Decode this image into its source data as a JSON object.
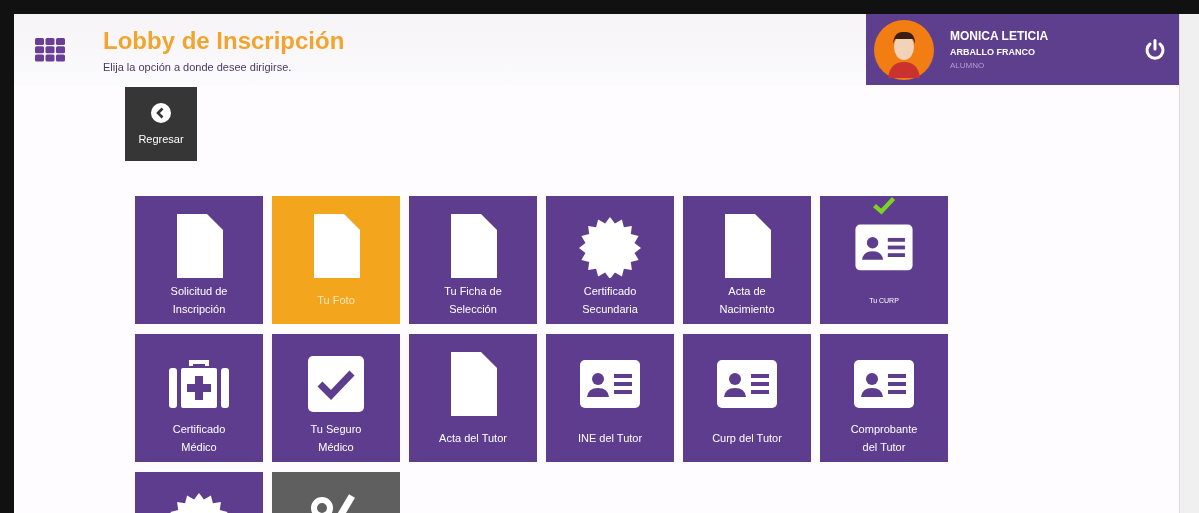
{
  "header": {
    "title": "Lobby de Inscripción",
    "subtitle": "Elija la opción a donde desee dirigirse."
  },
  "user": {
    "first_names": "MONICA LETICIA",
    "last_names": "ARBALLO FRANCO",
    "role": "ALUMNO"
  },
  "back_button": {
    "label": "Regresar"
  },
  "tiles": [
    {
      "kind": "document",
      "label": "Solicitud de Inscripción",
      "selected": false,
      "checked": false,
      "disabled": false
    },
    {
      "kind": "document",
      "label": "Tu Foto",
      "selected": true,
      "checked": false,
      "disabled": false
    },
    {
      "kind": "document",
      "label": "Tu Ficha de Selección",
      "selected": false,
      "checked": false,
      "disabled": false
    },
    {
      "kind": "seal",
      "label": "Certificado Secundaria",
      "selected": false,
      "checked": false,
      "disabled": false
    },
    {
      "kind": "document",
      "label": "Acta de Nacimiento",
      "selected": false,
      "checked": false,
      "disabled": false
    },
    {
      "kind": "id-card",
      "label": "Tu CURP",
      "selected": false,
      "checked": true,
      "disabled": false
    },
    {
      "kind": "medkit",
      "label": "Certificado Médico",
      "selected": false,
      "checked": false,
      "disabled": false
    },
    {
      "kind": "check",
      "label": "Tu Seguro Médico",
      "selected": false,
      "checked": false,
      "disabled": false
    },
    {
      "kind": "document",
      "label": "Acta del Tutor",
      "selected": false,
      "checked": false,
      "disabled": false
    },
    {
      "kind": "id-card",
      "label": "INE del Tutor",
      "selected": false,
      "checked": false,
      "disabled": false
    },
    {
      "kind": "id-card",
      "label": "Curp del Tutor",
      "selected": false,
      "checked": false,
      "disabled": false
    },
    {
      "kind": "id-card",
      "label": "Comprobante del Tutor",
      "selected": false,
      "checked": false,
      "disabled": false
    },
    {
      "kind": "seal",
      "selected": false,
      "checked": false,
      "disabled": false
    },
    {
      "kind": "percent",
      "selected": false,
      "checked": false,
      "disabled": true
    }
  ]
}
